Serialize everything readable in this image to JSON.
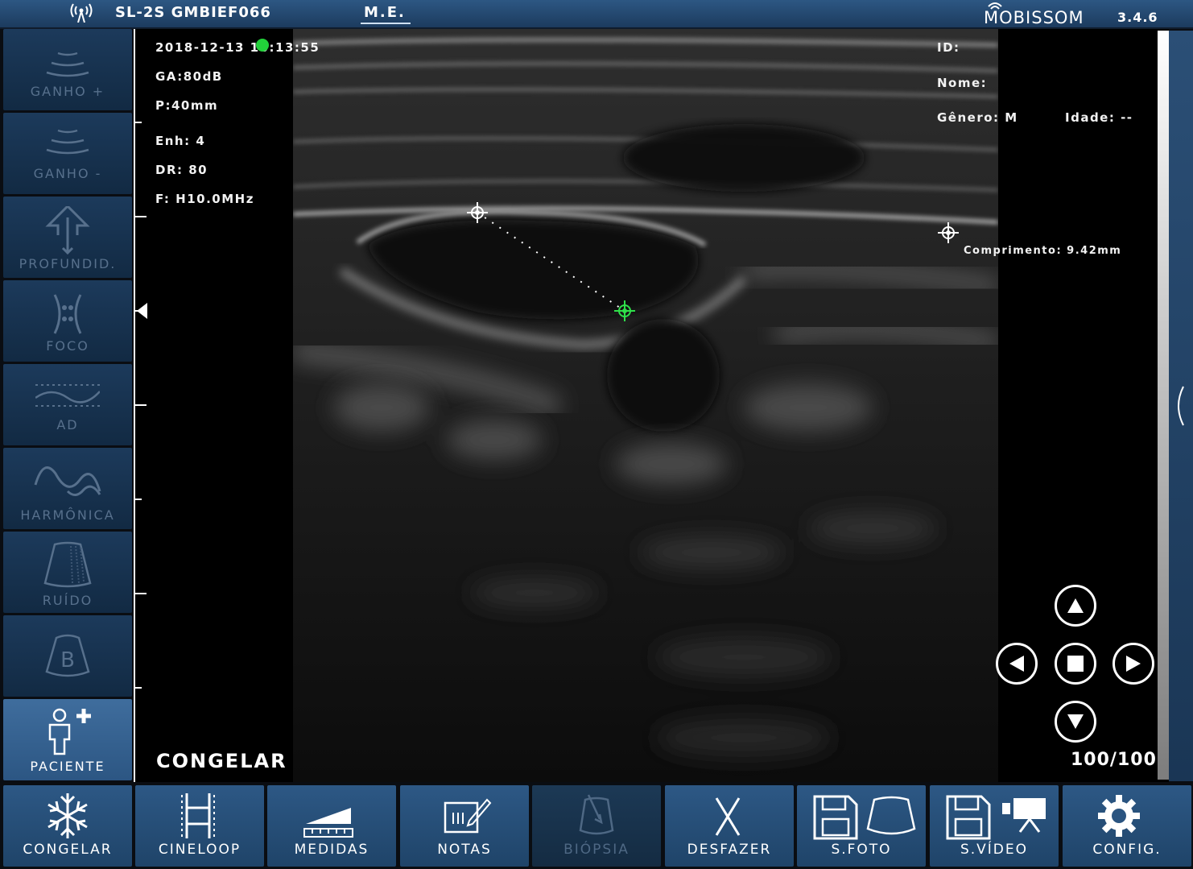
{
  "topbar": {
    "device": "SL-2S GMBIEF066",
    "mode": "M.E.",
    "brand": "MOBISSOM",
    "version": "3.4.6",
    "signal_icon": "antenna-icon"
  },
  "left_toolbar": [
    {
      "label": "GANHO +",
      "icon": "gain-up-icon"
    },
    {
      "label": "GANHO -",
      "icon": "gain-down-icon"
    },
    {
      "label": "PROFUNDID.",
      "icon": "depth-icon"
    },
    {
      "label": "FOCO",
      "icon": "focus-icon"
    },
    {
      "label": "AD",
      "icon": "dynamic-range-icon"
    },
    {
      "label": "HARMÔNICA",
      "icon": "harmonic-icon"
    },
    {
      "label": "RUÍDO",
      "icon": "noise-icon"
    },
    {
      "label": "",
      "icon": "b-mode-icon"
    },
    {
      "label": "PACIENTE",
      "icon": "patient-add-icon"
    }
  ],
  "image_info": {
    "datetime": "2018-12-13 10:13:55",
    "ga": "GA:80dB",
    "p": "P:40mm",
    "enh": "Enh: 4",
    "dr": "DR: 80",
    "f": "F: H10.0MHz"
  },
  "patient": {
    "id_label": "ID:",
    "name_label": "Nome:",
    "gender_label": "Gênero: M",
    "age_label": "Idade: --"
  },
  "measurement": {
    "label": "Comprimento: 9.42mm"
  },
  "status": {
    "freeze_label": "CONGELAR",
    "frames": "100/100"
  },
  "colors": {
    "accent": "#2c5683",
    "caliper_active": "#2fe04a",
    "caliper_idle": "#ffffff"
  },
  "bottom_toolbar": [
    {
      "label": "CONGELAR",
      "icon": "snowflake-icon",
      "enabled": true
    },
    {
      "label": "CINELOOP",
      "icon": "film-strip-icon",
      "enabled": true
    },
    {
      "label": "MEDIDAS",
      "icon": "ruler-icon",
      "enabled": true
    },
    {
      "label": "NOTAS",
      "icon": "notes-icon",
      "enabled": true
    },
    {
      "label": "BIÓPSIA",
      "icon": "biopsy-icon",
      "enabled": false
    },
    {
      "label": "DESFAZER",
      "icon": "undo-x-icon",
      "enabled": true
    },
    {
      "label": "S.FOTO",
      "icon": "save-photo-icon",
      "enabled": true
    },
    {
      "label": "S.VÍDEO",
      "icon": "save-video-icon",
      "enabled": true
    },
    {
      "label": "CONFIG.",
      "icon": "gear-icon",
      "enabled": true
    }
  ]
}
